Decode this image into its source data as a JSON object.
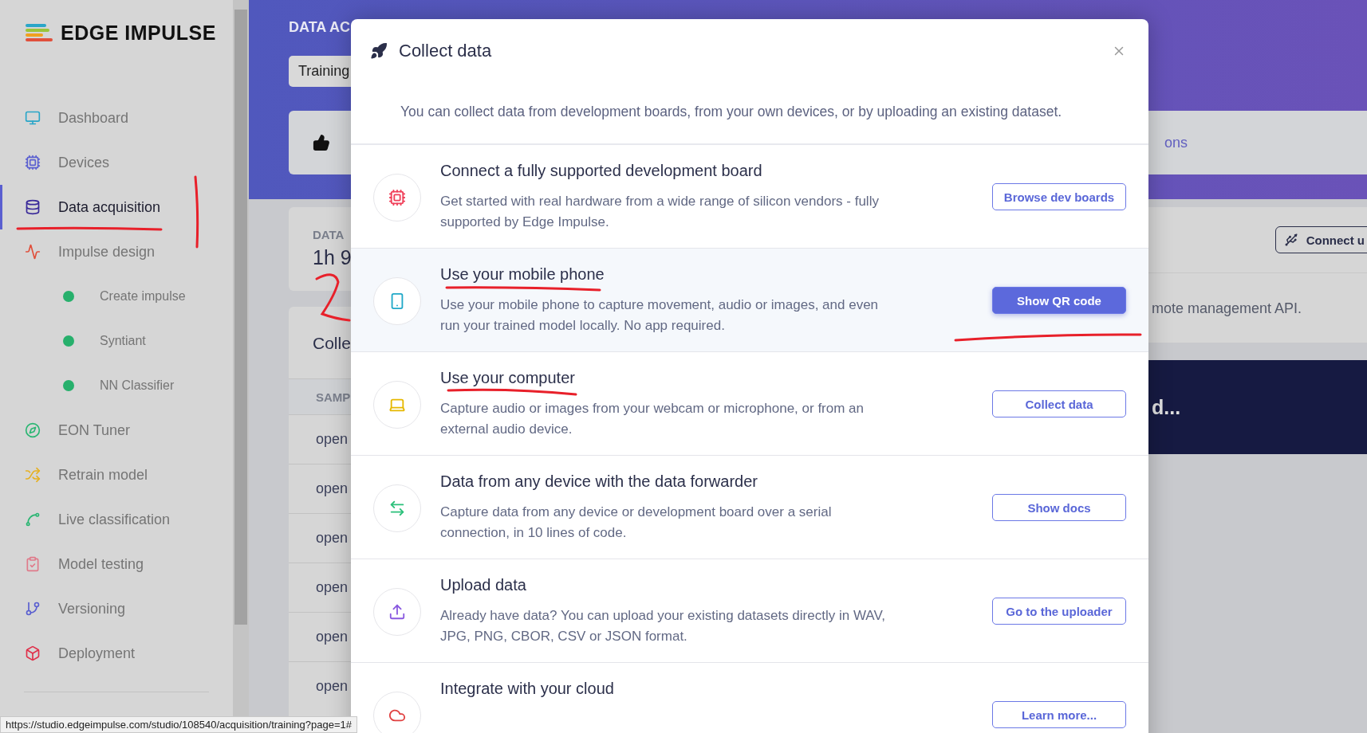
{
  "sidebar": {
    "logo": "EDGE IMPULSE",
    "items": [
      {
        "label": "Dashboard",
        "selected": false
      },
      {
        "label": "Devices",
        "selected": false
      },
      {
        "label": "Data acquisition",
        "selected": true
      },
      {
        "label": "Impulse design",
        "selected": false,
        "children": [
          {
            "label": "Create impulse",
            "selected": false
          },
          {
            "label": "Syntiant",
            "selected": false
          },
          {
            "label": "NN Classifier",
            "selected": false
          }
        ]
      },
      {
        "label": "EON Tuner",
        "selected": false
      },
      {
        "label": "Retrain model",
        "selected": false
      },
      {
        "label": "Live classification",
        "selected": false
      },
      {
        "label": "Model testing",
        "selected": false
      },
      {
        "label": "Versioning",
        "selected": false
      },
      {
        "label": "Deployment",
        "selected": false
      }
    ]
  },
  "page": {
    "title": "DATA AC",
    "tabs": [
      {
        "label": "Training",
        "selected": true
      }
    ],
    "link": "ons",
    "data_label": "DATA",
    "data_value": "1h 9",
    "connect_button": "Connect u",
    "api_text": "mote management API.",
    "banner_text": "d...",
    "collected_title": "Colle",
    "column_1": "SAMP",
    "rows": [
      "open",
      "open",
      "open",
      "open",
      "open",
      "open"
    ]
  },
  "modal": {
    "title": "Collect data",
    "intro": "You can collect data from development boards, from your own devices, or by uploading an existing dataset.",
    "options": [
      {
        "title": "Connect a fully supported development board",
        "description": "Get started with real hardware from a wide range of silicon vendors - fully supported by Edge Impulse.",
        "button": "Browse dev boards",
        "selected": false
      },
      {
        "title": "Use your mobile phone",
        "description": "Use your mobile phone to capture movement, audio or images, and even run your trained model locally. No app required.",
        "button": "Show QR code",
        "selected": true
      },
      {
        "title": "Use your computer",
        "description": "Capture audio or images from your webcam or microphone, or from an external audio device.",
        "button": "Collect data",
        "selected": false
      },
      {
        "title": "Data from any device with the data forwarder",
        "description": "Capture data from any device or development board over a serial connection, in 10 lines of code.",
        "button": "Show docs",
        "selected": false
      },
      {
        "title": "Upload data",
        "description": "Already have data? You can upload your existing datasets directly in WAV, JPG, PNG, CBOR, CSV or JSON format.",
        "button": "Go to the uploader",
        "selected": false
      },
      {
        "title": "Integrate with your cloud",
        "button": "Learn more...",
        "selected": false
      }
    ]
  },
  "status_bar": {
    "url": "https://studio.edgeimpulse.com/studio/108540/acquisition/training?page=1#"
  }
}
